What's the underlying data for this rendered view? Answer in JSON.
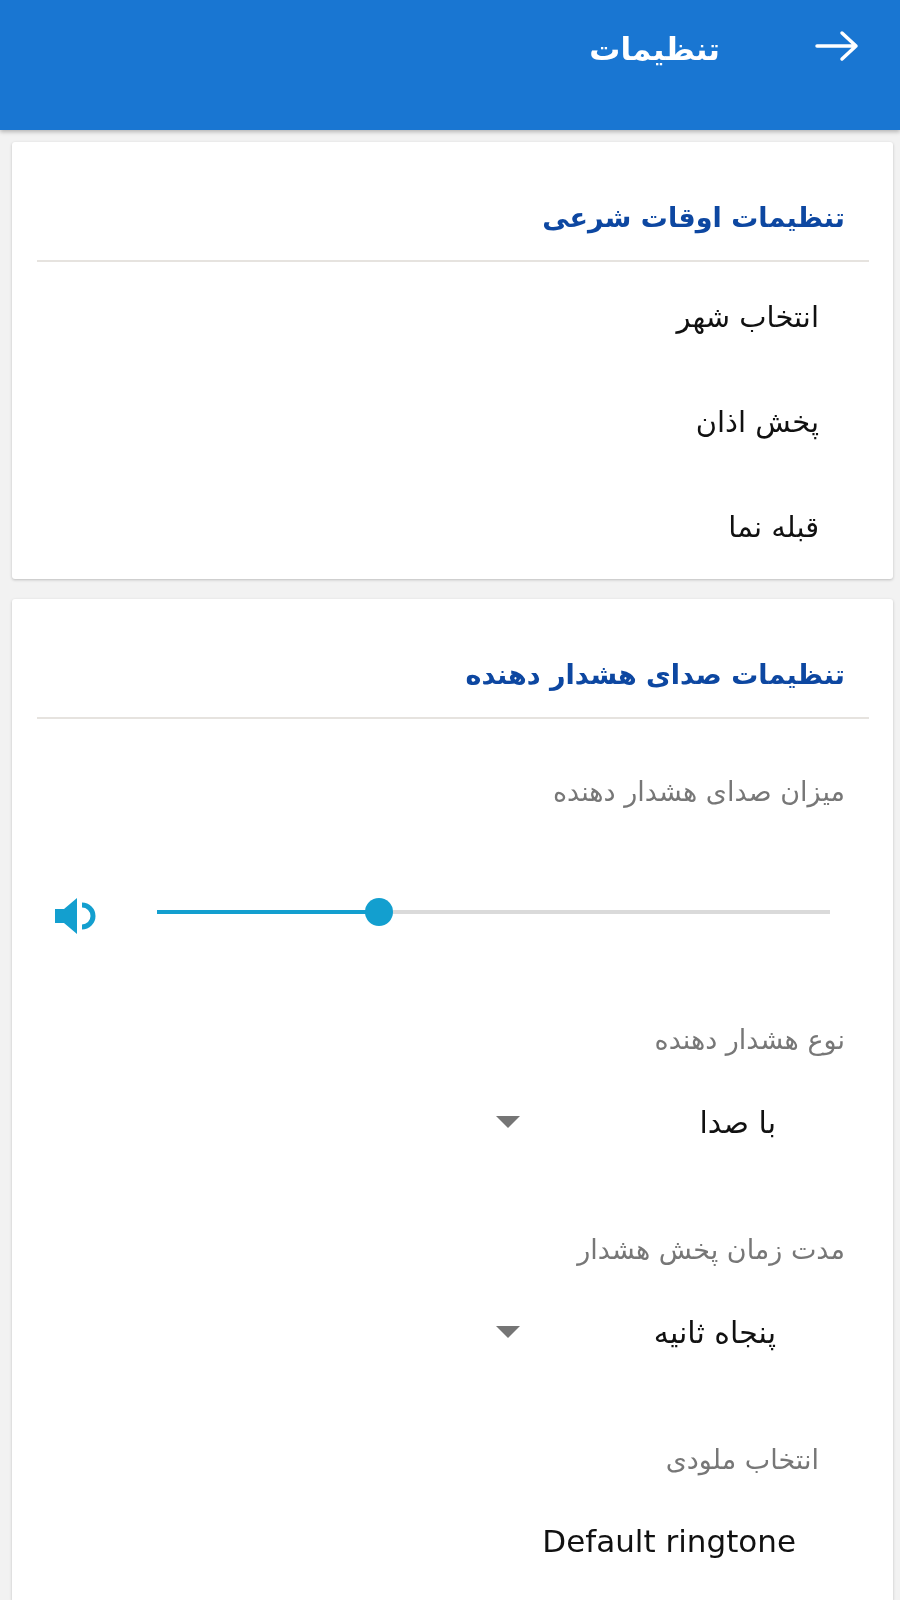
{
  "app_bar": {
    "title": "تنظیمات"
  },
  "sections": [
    {
      "title": "تنظیمات اوقات شرعی",
      "items": [
        {
          "kind": "action",
          "label": "انتخاب شهر"
        },
        {
          "kind": "action",
          "label": "پخش اذان"
        },
        {
          "kind": "action",
          "label": "قبله نما"
        }
      ]
    },
    {
      "title": "تنظیمات صدای هشدار دهنده",
      "items": [
        {
          "kind": "slider",
          "label": "میزان صدای هشدار دهنده",
          "level": 0.33
        },
        {
          "kind": "dropdown",
          "label": "نوع هشدار دهنده",
          "value": "با صدا"
        },
        {
          "kind": "dropdown",
          "label": "مدت زمان پخش هشدار",
          "value": "پنجاه ثانیه"
        },
        {
          "kind": "preference",
          "label": "انتخاب ملودی",
          "value": "Default ringtone"
        }
      ]
    }
  ]
}
